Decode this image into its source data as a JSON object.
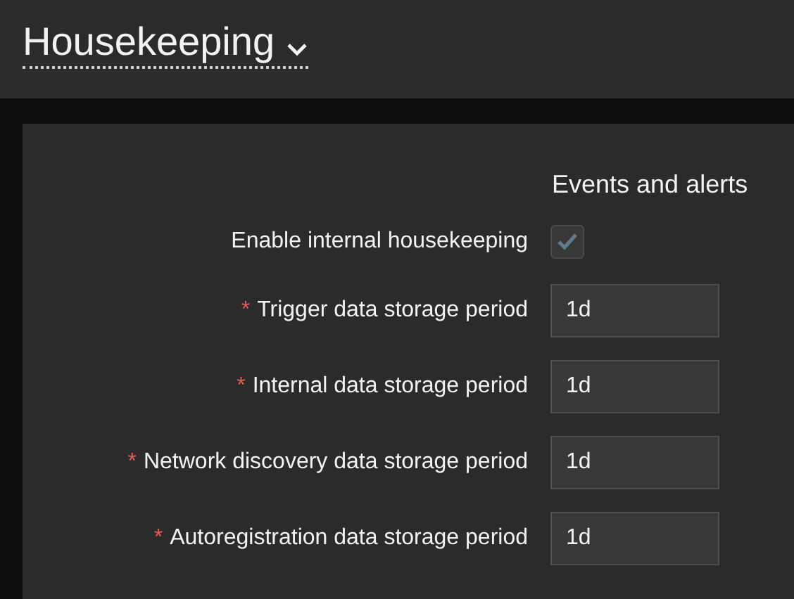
{
  "page": {
    "title": "Housekeeping",
    "title_menu": true
  },
  "section": {
    "heading": "Events and alerts"
  },
  "required_mark": "*",
  "fields": [
    {
      "kind": "checkbox",
      "label": "Enable internal housekeeping",
      "required": false,
      "checked": true,
      "disabled": true
    },
    {
      "kind": "text",
      "label": "Trigger data storage period",
      "required": true,
      "value": "1d"
    },
    {
      "kind": "text",
      "label": "Internal data storage period",
      "required": true,
      "value": "1d"
    },
    {
      "kind": "text",
      "label": "Network discovery data storage period",
      "required": true,
      "value": "1d"
    },
    {
      "kind": "text",
      "label": "Autoregistration data storage period",
      "required": true,
      "value": "1d"
    }
  ]
}
